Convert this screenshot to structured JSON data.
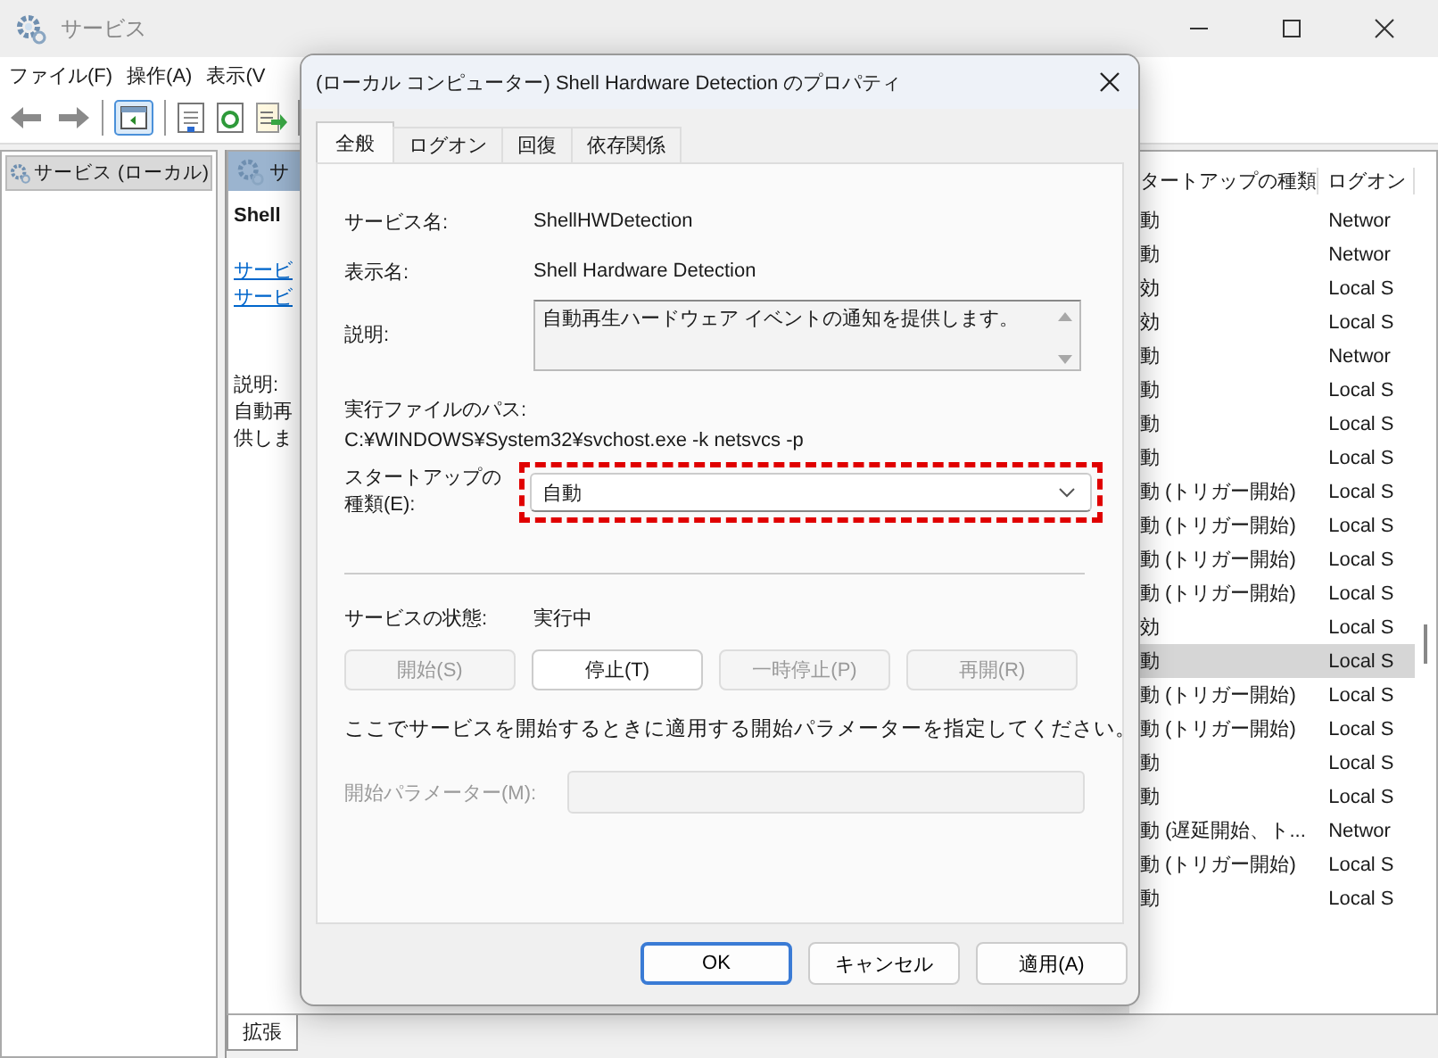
{
  "window": {
    "title": "サービス"
  },
  "menu": [
    "ファイル(F)",
    "操作(A)",
    "表示(V"
  ],
  "tree": [
    {
      "label": "サービス (ローカル)",
      "selected": true
    }
  ],
  "detail_panel": {
    "header": "サ",
    "service_name": "Shell",
    "links": [
      "サービ",
      "サービ"
    ],
    "description_label": "説明:",
    "description_lines": [
      "自動再",
      "供しま"
    ]
  },
  "list": {
    "columns": [
      "タートアップの種類",
      "ログオン"
    ],
    "rows": [
      {
        "startup": "動",
        "logon": "Networ",
        "selected": false
      },
      {
        "startup": "動",
        "logon": "Networ",
        "selected": false
      },
      {
        "startup": "効",
        "logon": "Local S",
        "selected": false
      },
      {
        "startup": "効",
        "logon": "Local S",
        "selected": false
      },
      {
        "startup": "動",
        "logon": "Networ",
        "selected": false
      },
      {
        "startup": "動",
        "logon": "Local S",
        "selected": false
      },
      {
        "startup": "動",
        "logon": "Local S",
        "selected": false
      },
      {
        "startup": "動",
        "logon": "Local S",
        "selected": false
      },
      {
        "startup": "動 (トリガー開始)",
        "logon": "Local S",
        "selected": false
      },
      {
        "startup": "動 (トリガー開始)",
        "logon": "Local S",
        "selected": false
      },
      {
        "startup": "動 (トリガー開始)",
        "logon": "Local S",
        "selected": false
      },
      {
        "startup": "動 (トリガー開始)",
        "logon": "Local S",
        "selected": false
      },
      {
        "startup": "効",
        "logon": "Local S",
        "selected": false
      },
      {
        "startup": "動",
        "logon": "Local S",
        "selected": true
      },
      {
        "startup": "動 (トリガー開始)",
        "logon": "Local S",
        "selected": false
      },
      {
        "startup": "動 (トリガー開始)",
        "logon": "Local S",
        "selected": false
      },
      {
        "startup": "動",
        "logon": "Local S",
        "selected": false
      },
      {
        "startup": "動",
        "logon": "Local S",
        "selected": false
      },
      {
        "startup": "動 (遅延開始、ト...",
        "logon": "Networ",
        "selected": false
      },
      {
        "startup": "動 (トリガー開始)",
        "logon": "Local S",
        "selected": false
      },
      {
        "startup": "動",
        "logon": "Local S",
        "selected": false
      }
    ]
  },
  "view_tabs": [
    {
      "label": "拡張",
      "selected": true
    }
  ],
  "dialog": {
    "title": "(ローカル コンピューター) Shell Hardware Detection のプロパティ",
    "tabs": [
      {
        "label": "全般",
        "selected": true
      },
      {
        "label": "ログオン",
        "selected": false
      },
      {
        "label": "回復",
        "selected": false
      },
      {
        "label": "依存関係",
        "selected": false
      }
    ],
    "fields": [
      {
        "label": "サービス名:",
        "value": "ShellHWDetection"
      },
      {
        "label": "表示名:",
        "value": "Shell Hardware Detection"
      }
    ],
    "description": {
      "label": "説明:",
      "value": "自動再生ハードウェア イベントの通知を提供します。"
    },
    "path": {
      "label": "実行ファイルのパス:",
      "value": "C:¥WINDOWS¥System32¥svchost.exe -k netsvcs -p"
    },
    "startup": {
      "label_lines": [
        "スタートアップの",
        "種類(E):"
      ],
      "value": "自動",
      "highlighted": true
    },
    "status": {
      "label": "サービスの状態:",
      "value": "実行中"
    },
    "service_buttons": [
      {
        "label": "開始(S)",
        "disabled": true
      },
      {
        "label": "停止(T)",
        "disabled": false
      },
      {
        "label": "一時停止(P)",
        "disabled": true
      },
      {
        "label": "再開(R)",
        "disabled": true
      }
    ],
    "hint": "ここでサービスを開始するときに適用する開始パラメーターを指定してください。",
    "start_params": {
      "label": "開始パラメーター(M):",
      "disabled": true
    },
    "buttons": [
      {
        "label": "OK",
        "kind": "primary"
      },
      {
        "label": "キャンセル",
        "kind": "normal"
      },
      {
        "label": "適用(A)",
        "kind": "normal"
      }
    ]
  }
}
